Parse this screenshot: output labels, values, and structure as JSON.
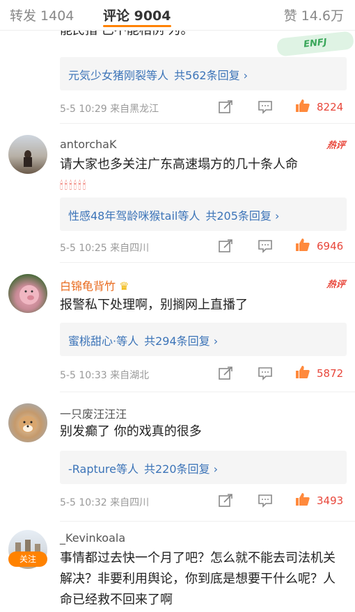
{
  "tabs": {
    "repost": "转发 1404",
    "comments": "评论 9004",
    "likes": "赞 14.6万"
  },
  "colors": {
    "accent": "#ff8200",
    "link": "#3c74b8",
    "like": "#e8463a"
  },
  "top_partial": {
    "text_fragment": "能民指 已不能相例 为。",
    "sticker": "ENFJ",
    "reply_names": "元気少女猪刚裂",
    "reply_suffix": "等人",
    "reply_total": "共562条回复",
    "chevron": "›",
    "time": "5-5 10:29",
    "source": "来自黑龙江",
    "likes": "8224"
  },
  "comments": [
    {
      "user": "antorchaK",
      "hot_label": "热评",
      "text": "请大家也多关注广东高速塌方的几十条人命",
      "emoji": "🕯🕯🕯🕯🕯🕯",
      "reply_names": "性感48年驾龄咪猴tail",
      "reply_suffix": "等人",
      "reply_total": "共205条回复",
      "chevron": "›",
      "time": "5-5 10:25",
      "source": "来自四川",
      "likes": "6946"
    },
    {
      "user": "白锦龟背竹",
      "crown": "♛",
      "hot_label": "热评",
      "text": "报警私下处理啊，别搁网上直播了",
      "reply_names": "蜜桃甜心·",
      "reply_suffix": "等人",
      "reply_total": "共294条回复",
      "chevron": "›",
      "time": "5-5 10:33",
      "source": "来自湖北",
      "likes": "5872"
    },
    {
      "user": "一只废汪汪汪",
      "text": "别发癫了 你的戏真的很多",
      "reply_names": "-Rapture",
      "reply_suffix": "等人",
      "reply_total": "共220条回复",
      "chevron": "›",
      "time": "5-5 10:32",
      "source": "来自四川",
      "likes": "3493"
    },
    {
      "user": "_Kevinkoala",
      "follow_label": "关注",
      "text": "事情都过去快一个月了吧？怎么就不能去司法机关解决？非要利用舆论，你到底是想要干什么呢？人命已经救不回来了啊"
    }
  ]
}
